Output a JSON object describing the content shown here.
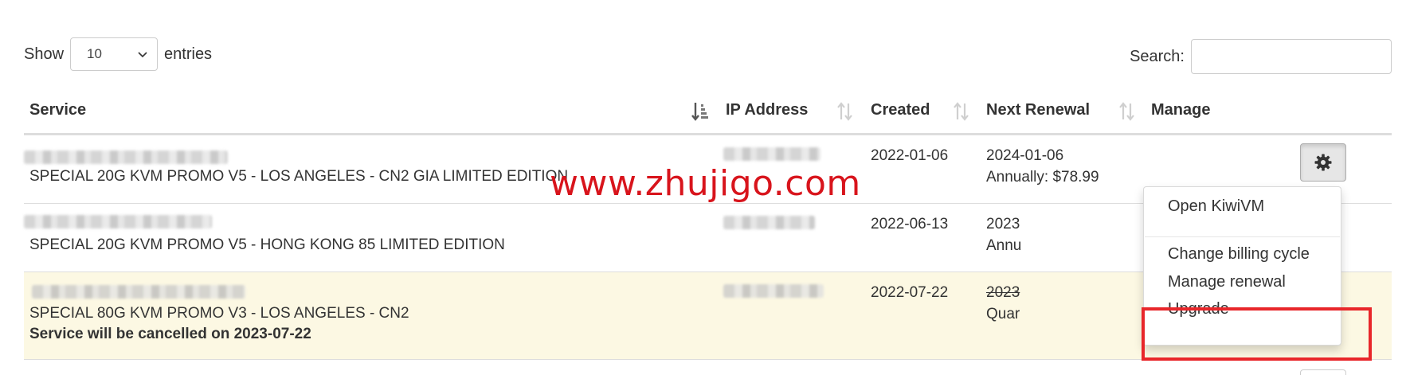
{
  "length_control": {
    "show_label": "Show",
    "selected": "10",
    "entries_label": "entries"
  },
  "search": {
    "label": "Search:",
    "value": ""
  },
  "columns": {
    "service": "Service",
    "ip": "IP Address",
    "created": "Created",
    "renewal": "Next Renewal",
    "manage": "Manage"
  },
  "rows": [
    {
      "product": "SPECIAL 20G KVM PROMO V5 - LOS ANGELES - CN2 GIA LIMITED EDITION",
      "created": "2022-01-06",
      "renewal_date": "2024-01-06",
      "renewal_cycle": "Annually: $78.99"
    },
    {
      "product": "SPECIAL 20G KVM PROMO V5 - HONG KONG 85 LIMITED EDITION",
      "created": "2022-06-13",
      "renewal_date": "2023",
      "renewal_cycle": "Annu"
    },
    {
      "product": "SPECIAL 80G KVM PROMO V3 - LOS ANGELES - CN2",
      "note": "Service will be cancelled on 2023-07-22",
      "created": "2022-07-22",
      "renewal_date": "2023",
      "renewal_cycle": "Quar"
    }
  ],
  "dropdown": {
    "items": [
      "Open KiwiVM",
      "Change billing cycle",
      "Manage renewal",
      "Upgrade"
    ]
  },
  "watermark": "www.zhujigo.com",
  "colors": {
    "highlight": "#e8262a",
    "watermark": "#d8141c",
    "cancelled_row_bg": "#fcf8e3"
  }
}
